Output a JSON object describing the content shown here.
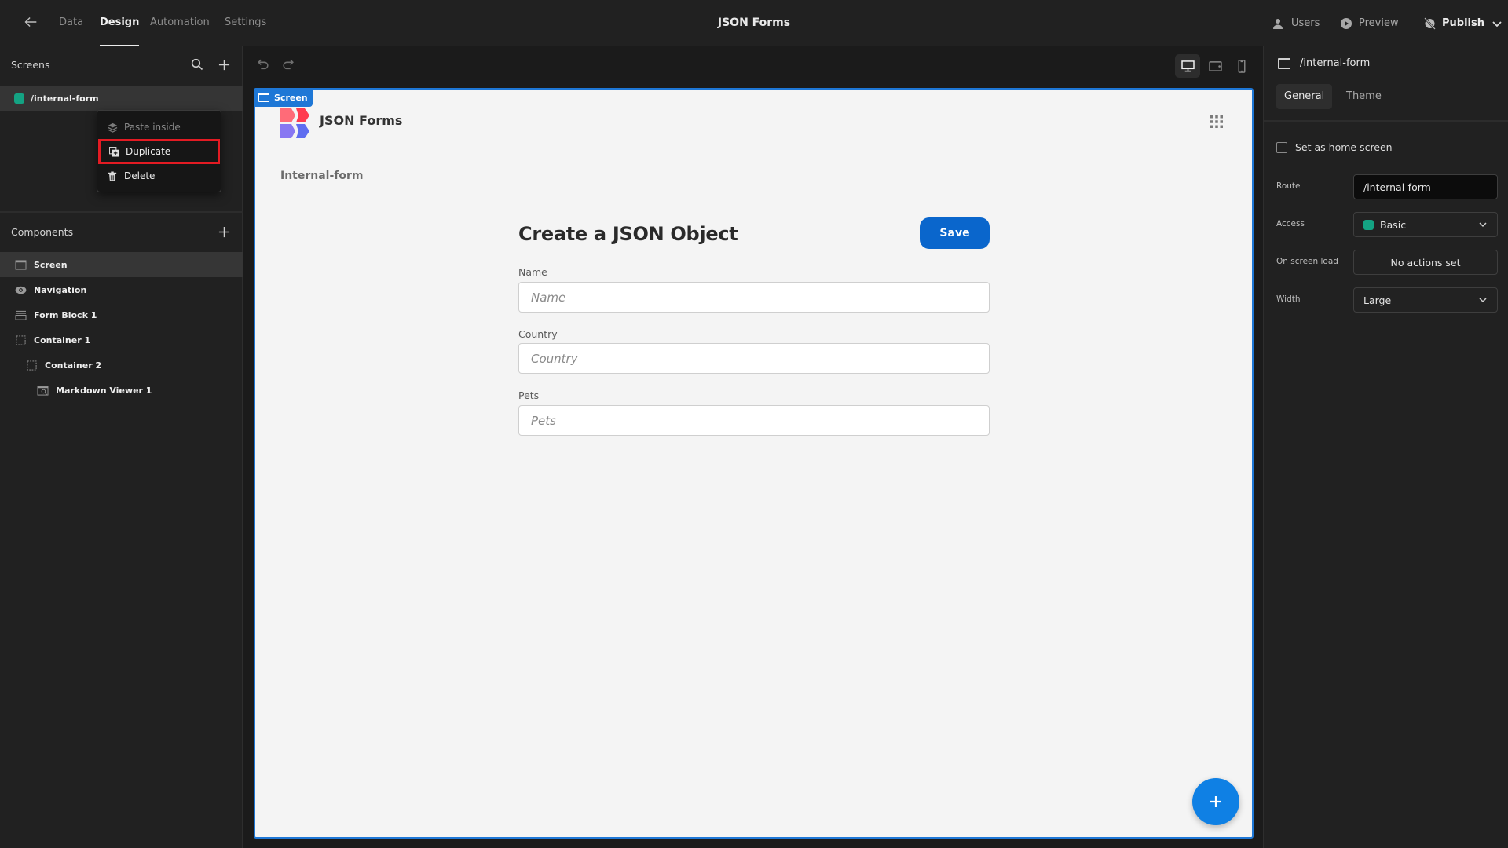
{
  "topbar": {
    "nav": [
      "Data",
      "Design",
      "Automation",
      "Settings"
    ],
    "active_nav": "Design",
    "title": "JSON Forms",
    "users_label": "Users",
    "preview_label": "Preview",
    "publish_label": "Publish"
  },
  "screens": {
    "heading": "Screens",
    "items": [
      {
        "route": "/internal-form",
        "color": "#14a383"
      }
    ]
  },
  "context_menu": {
    "items": [
      {
        "label": "Paste inside",
        "icon": "paste-icon",
        "disabled": true
      },
      {
        "label": "Duplicate",
        "icon": "duplicate-icon",
        "highlighted": true
      },
      {
        "label": "Delete",
        "icon": "trash-icon"
      }
    ]
  },
  "components": {
    "heading": "Components",
    "items": [
      {
        "label": "Screen",
        "icon": "screen-icon",
        "depth": 0,
        "selected": true
      },
      {
        "label": "Navigation",
        "icon": "eye-icon",
        "depth": 0
      },
      {
        "label": "Form Block 1",
        "icon": "form-icon",
        "depth": 0
      },
      {
        "label": "Container 1",
        "icon": "container-icon",
        "depth": 0
      },
      {
        "label": "Container 2",
        "icon": "container-icon",
        "depth": 1
      },
      {
        "label": "Markdown Viewer 1",
        "icon": "markdown-icon",
        "depth": 2
      }
    ]
  },
  "canvas": {
    "tag_label": "Screen",
    "brand": "JSON Forms",
    "nav_link": "Internal-form",
    "form": {
      "title": "Create a JSON Object",
      "save_label": "Save",
      "fields": [
        {
          "label": "Name",
          "placeholder": "Name"
        },
        {
          "label": "Country",
          "placeholder": "Country"
        },
        {
          "label": "Pets",
          "placeholder": "Pets"
        }
      ]
    },
    "accent": "#0a66cc"
  },
  "properties": {
    "route_title": "/internal-form",
    "tabs": [
      "General",
      "Theme"
    ],
    "active_tab": "General",
    "home_screen_label": "Set as home screen",
    "home_screen_checked": false,
    "route_label": "Route",
    "route_value": "/internal-form",
    "access_label": "Access",
    "access_value": "Basic",
    "on_load_label": "On screen load",
    "on_load_value": "No actions set",
    "width_label": "Width",
    "width_value": "Large"
  }
}
